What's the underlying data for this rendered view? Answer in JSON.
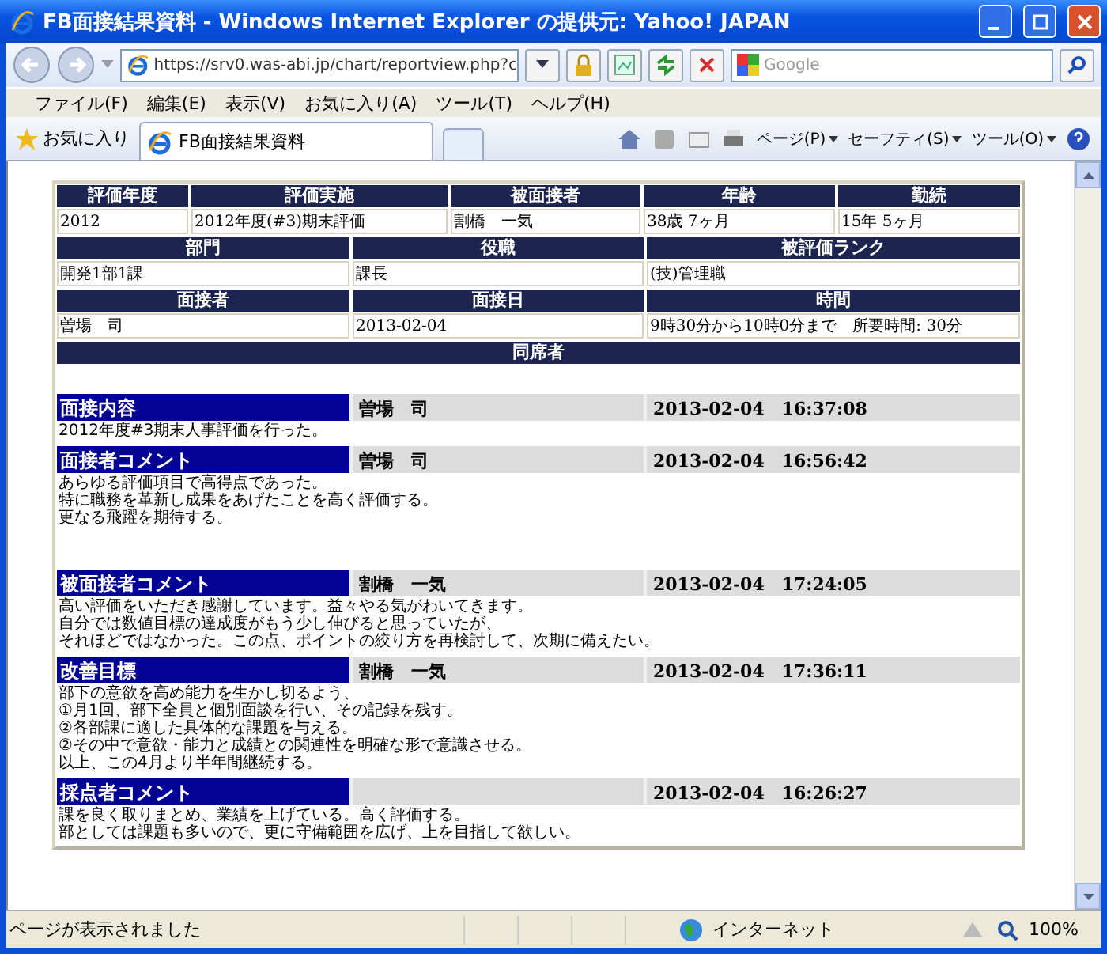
{
  "window": {
    "title": "FB面接結果資料 - Windows Internet Explorer の提供元: Yahoo! JAPAN"
  },
  "address": {
    "url": "https://srv0.was-abi.jp/chart/reportview.php?c",
    "search_placeholder": "Google"
  },
  "menu": [
    "ファイル(F)",
    "編集(E)",
    "表示(V)",
    "お気に入り(A)",
    "ツール(T)",
    "ヘルプ(H)"
  ],
  "favorites": "お気に入り",
  "tab": {
    "label": "FB面接結果資料",
    "selected": true
  },
  "commands": [
    "ページ(P)",
    "セーフティ(S)",
    "ツール(O)"
  ],
  "info_tables": [
    {
      "columns": [
        "評価年度",
        "評価実施",
        "被面接者",
        "年齢",
        "勤続"
      ],
      "rows": [
        [
          "2012",
          "2012年度(#3)期末評価",
          "割橋　一気",
          "38歳 7ヶ月",
          "15年 5ヶ月"
        ]
      ]
    },
    {
      "columns": [
        "部門",
        "役職",
        "被評価ランク"
      ],
      "rows": [
        [
          "開発1部1課",
          "課長",
          "(技)管理職"
        ]
      ]
    },
    {
      "columns": [
        "面接者",
        "面接日",
        "時間"
      ],
      "rows": [
        [
          "曽場　司",
          "2013-02-04",
          "9時30分から10時0分まで　所要時間: 30分"
        ]
      ]
    }
  ],
  "attendees": {
    "heading": "同席者"
  },
  "sections": [
    {
      "title": "面接内容",
      "author": "曽場　司",
      "timestamp": "2013-02-04　16:37:08",
      "lines": [
        "2012年度#3期末人事評価を行った。"
      ]
    },
    {
      "title": "面接者コメント",
      "author": "曽場　司",
      "timestamp": "2013-02-04　16:56:42",
      "lines": [
        "あらゆる評価項目で高得点であった。",
        "特に職務を革新し成果をあげたことを高く評価する。",
        "更なる飛躍を期待する。"
      ]
    },
    {
      "title": "被面接者コメント",
      "author": "割橋　一気",
      "timestamp": "2013-02-04　17:24:05",
      "lines": [
        "高い評価をいただき感謝しています。益々やる気がわいてきます。",
        "自分では数値目標の達成度がもう少し伸びると思っていたが、",
        "それほどではなかった。この点、ポイントの絞り方を再検討して、次期に備えたい。"
      ]
    },
    {
      "title": "改善目標",
      "author": "割橋　一気",
      "timestamp": "2013-02-04　17:36:11",
      "lines": [
        "部下の意欲を高め能力を生かし切るよう、",
        "①月1回、部下全員と個別面談を行い、その記録を残す。",
        "②各部課に適した具体的な課題を与える。",
        "②その中で意欲・能力と成績との関連性を明確な形で意識させる。",
        "以上、この4月より半年間継続する。"
      ]
    },
    {
      "title": "採点者コメント",
      "timestamp": "2013-02-04　16:26:27",
      "lines": [
        "課を良く取りまとめ、業績を上げている。高く評価する。",
        "部としては課題も多いので、更に守備範囲を広げ、上を目指して欲しい。"
      ]
    }
  ],
  "status_bar": {
    "message": "ページが表示されました",
    "zone": "インターネット",
    "zoom": "100%"
  }
}
